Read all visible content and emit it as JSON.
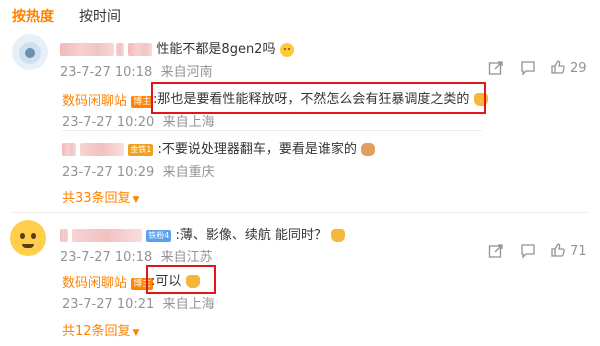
{
  "tabs": {
    "hot": "按热度",
    "time": "按时间"
  },
  "comments": [
    {
      "text": "性能不都是8gen2吗",
      "date": "23-7-27 10:18",
      "location": "来自河南",
      "likes": "29",
      "replies": [
        {
          "author": "数码闲聊站",
          "badge": "博主",
          "text": ":那也是要看性能释放呀，不然怎么会有狂暴调度之类的",
          "date": "23-7-27 10:20",
          "location": "来自上海"
        },
        {
          "badge": "金铁1",
          "text": ":不要说处理器翻车，要看是谁家的",
          "date": "23-7-27 10:29",
          "location": "来自重庆"
        }
      ],
      "more": "共33条回复"
    },
    {
      "badge": "铁粉4",
      "text": ":薄、影像、续航 能同时？",
      "date": "23-7-27 10:18",
      "location": "来自江苏",
      "likes": "71",
      "replies": [
        {
          "author": "数码闲聊站",
          "badge": "博主",
          "text": ":可以",
          "date": "23-7-27 10:21",
          "location": "来自上海"
        }
      ],
      "more": "共12条回复"
    }
  ],
  "icons": [
    "share-icon",
    "comment-icon",
    "like-icon",
    "dropdown-triangle-icon"
  ],
  "colors": {
    "accent": "#ff8200",
    "highlight_box": "#e0161c",
    "meta_text": "#939393"
  }
}
